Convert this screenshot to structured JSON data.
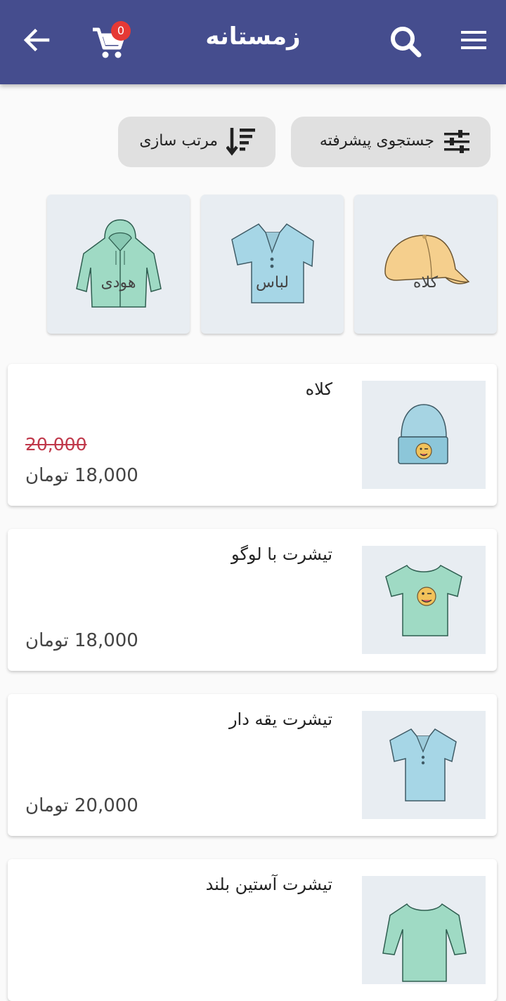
{
  "appbar": {
    "title": "زمستانه",
    "cart_count": "0",
    "icons": [
      "back-arrow-icon",
      "cart-icon",
      "search-icon",
      "menu-icon"
    ],
    "color": "#454d8e"
  },
  "filters": {
    "advanced_search_label": "جستجوی پیشرفته",
    "sort_label": "مرتب سازی"
  },
  "categories": [
    {
      "label": "کلاه",
      "icon": "cap-icon"
    },
    {
      "label": "لباس",
      "icon": "polo-shirt-icon"
    },
    {
      "label": "هودی",
      "icon": "hoodie-icon"
    }
  ],
  "products": [
    {
      "name": "کلاه",
      "old_price": "20,000",
      "price": "18,000 تومان",
      "icon": "beanie-icon"
    },
    {
      "name": "تیشرت با لوگو",
      "price": "18,000 تومان",
      "icon": "tshirt-logo-icon"
    },
    {
      "name": "تیشرت یقه دار",
      "price": "20,000 تومان",
      "icon": "polo-shirt-icon"
    },
    {
      "name": "تیشرت آستین بلند",
      "icon": "long-sleeve-icon"
    }
  ],
  "colors": {
    "strike_price": "#c0394b",
    "badge": "#e53935"
  }
}
